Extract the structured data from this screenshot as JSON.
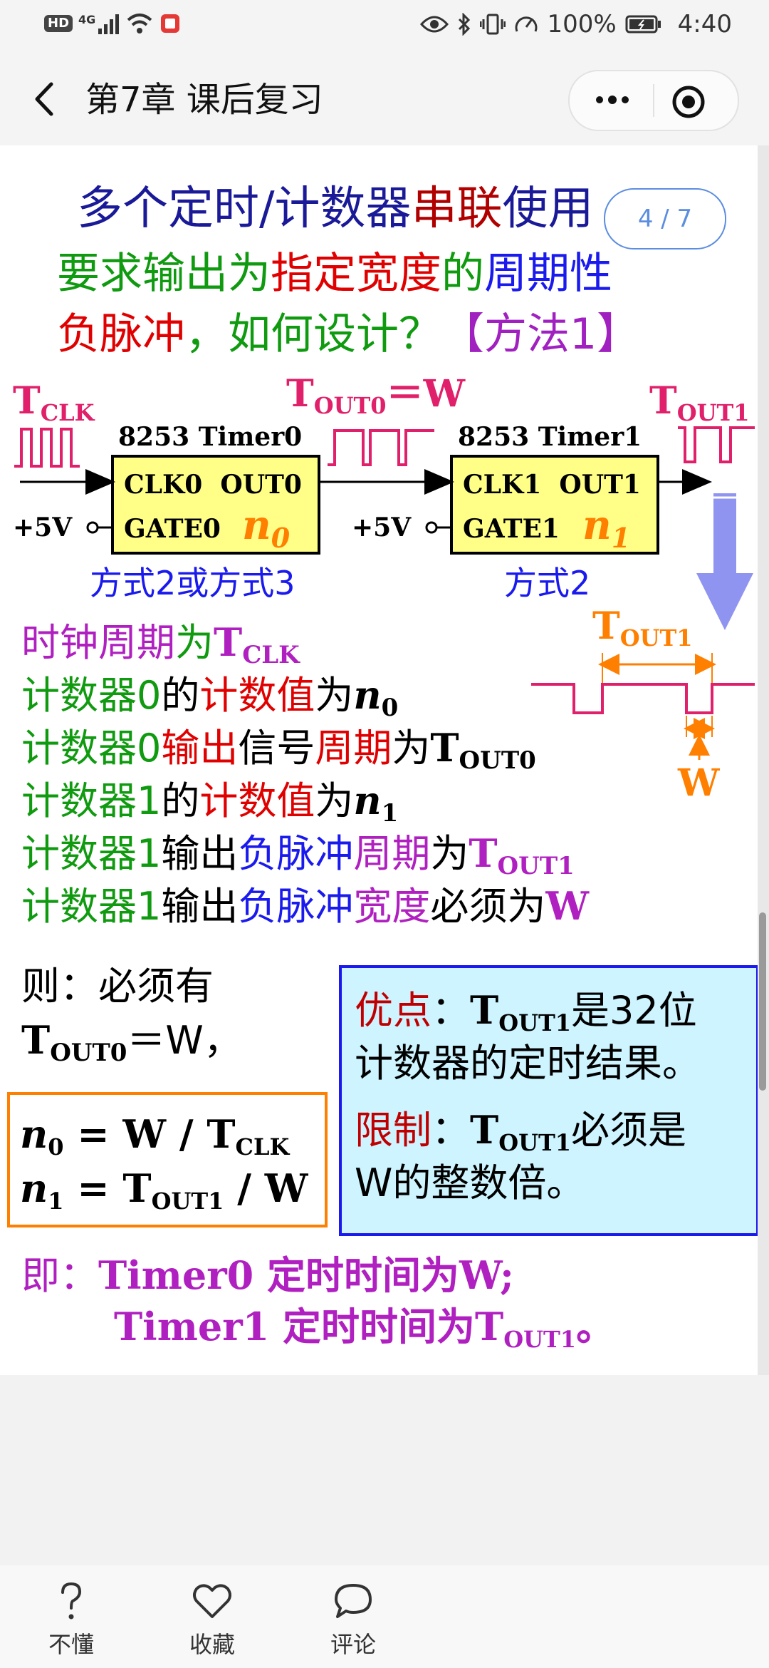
{
  "status": {
    "hd": "HD",
    "net": "4G",
    "battery": "100%",
    "time": "4:40"
  },
  "header": {
    "title": "第7章 课后复习"
  },
  "slide": {
    "title_a": "多个定时/计数器",
    "title_b": "串联",
    "title_c": "使用",
    "q1_a": "要求输出为",
    "q1_b": "指定宽度",
    "q1_c": "的",
    "q1_d": "周期性",
    "q2_a": "负脉冲",
    "q2_b": "，如何设计？",
    "q2_c": "【方法1】",
    "d_tclk_t": "T",
    "d_tclk_s": "CLK",
    "d_tout0_t": "T",
    "d_tout0_s": "OUT0",
    "d_tout0_eq": "＝W",
    "d_tout1_t": "T",
    "d_tout1_s": "OUT1",
    "box0_title": "8253 Timer0",
    "box0_l1": "CLK0  OUT0",
    "box0_l2": "GATE0",
    "box0_n": "n",
    "box0_nsub": "0",
    "box1_title": "8253 Timer1",
    "box1_l1": "CLK1  OUT1",
    "box1_l2": "GATE1",
    "box1_n": "n",
    "box1_nsub": "1",
    "plus5v": "+5V",
    "mode0": "方式2或方式3",
    "mode1": "方式2",
    "wf_tout1_t": "T",
    "wf_tout1_s": "OUT1",
    "wf_w": "W",
    "l1_a": "时钟周期",
    "l1_b": "为",
    "l1_c": "T",
    "l1_cs": "CLK",
    "l2_a": "计数器0",
    "l2_b": "的",
    "l2_c": "计数值",
    "l2_d": "为",
    "l2_n": "n",
    "l2_ns": "0",
    "l3_a": "计数器0",
    "l3_b": "输出",
    "l3_c": "信号",
    "l3_d": "周期",
    "l3_e": "为",
    "l3_t": "T",
    "l3_ts": "OUT0",
    "l4_a": "计数器1",
    "l4_b": "的",
    "l4_c": "计数值",
    "l4_d": "为",
    "l4_n": "n",
    "l4_ns": "1",
    "l5_a": "计数器1",
    "l5_b": "输出",
    "l5_c": "负脉冲",
    "l5_d": "周期",
    "l5_e": "为",
    "l5_t": "T",
    "l5_ts": "OUT1",
    "l6_a": "计数器1",
    "l6_b": "输出",
    "l6_c": "负脉冲",
    "l6_d": "宽度",
    "l6_e": "必须为",
    "l6_w": "W",
    "then1": "则：必须有",
    "then2_t": "T",
    "then2_s": "OUT0",
    "then2_r": "＝W，",
    "f1_n": "n",
    "f1_ns": "0",
    "f1_eq": " = W / T",
    "f1_s": "CLK",
    "f2_n": "n",
    "f2_ns": "1",
    "f2_eq": " = T",
    "f2_s": "OUT1",
    "f2_r": " / W",
    "adv_label": "优点",
    "adv_colon": "：",
    "adv_t": "T",
    "adv_ts": "OUT1",
    "adv_rest": "是32位",
    "adv_l2": "计数器的定时结果。",
    "lim_label": "限制",
    "lim_colon": "：",
    "lim_t": "T",
    "lim_ts": "OUT1",
    "lim_rest": "必须是",
    "lim_l2": "W的整数倍。",
    "sum_label": "即：",
    "sum1": "Timer0 定时时间为W;",
    "sum2_a": "Timer1 定时时间为T",
    "sum2_s": "OUT1",
    "sum2_b": "。"
  },
  "pager": {
    "text": "4 / 7"
  },
  "bottom": {
    "b1": "不懂",
    "b2": "收藏",
    "b3": "评论"
  }
}
